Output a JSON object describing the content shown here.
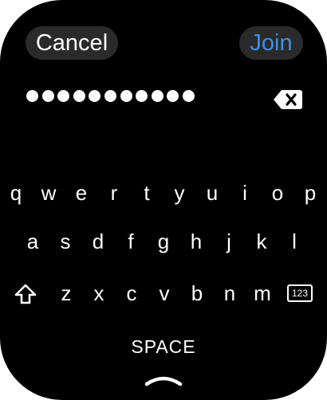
{
  "header": {
    "cancel_label": "Cancel",
    "join_label": "Join"
  },
  "password": {
    "masked_value": "●●●●●●●●●●●",
    "character_count": 11
  },
  "icons": {
    "delete": "delete-backspace-icon",
    "shift": "shift-arrow-up-icon",
    "handle": "chevron-up-icon"
  },
  "keyboard": {
    "row1": [
      "q",
      "w",
      "e",
      "r",
      "t",
      "y",
      "u",
      "i",
      "o",
      "p"
    ],
    "row2": [
      "a",
      "s",
      "d",
      "f",
      "g",
      "h",
      "j",
      "k",
      "l"
    ],
    "row3": [
      "z",
      "x",
      "c",
      "v",
      "b",
      "n",
      "m"
    ],
    "numbers_key_label": "123",
    "space_label": "SPACE"
  },
  "colors": {
    "background": "#000000",
    "pill": "#2a2a2a",
    "accent": "#3d8ee9",
    "text": "#ffffff"
  }
}
